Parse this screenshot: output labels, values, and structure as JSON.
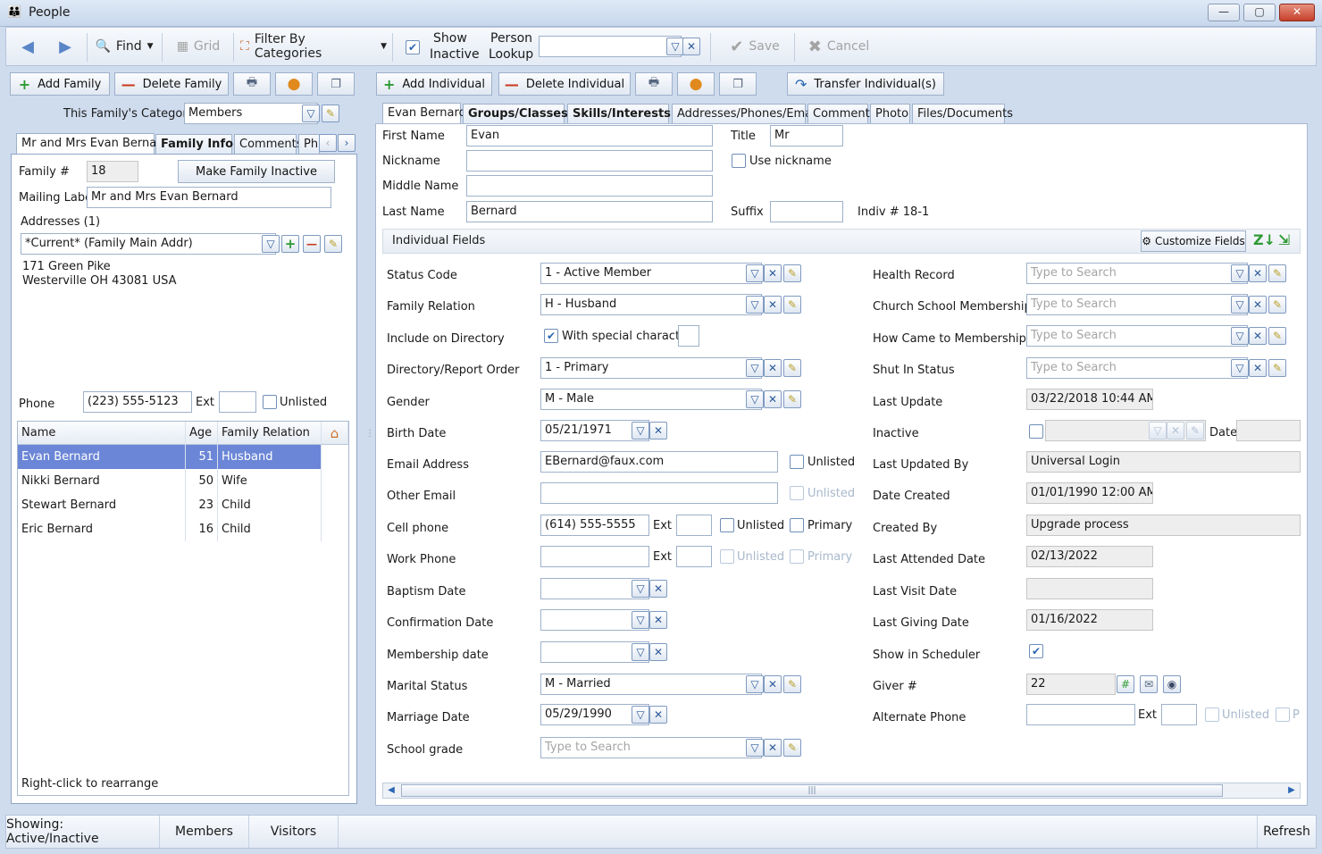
{
  "window": {
    "title": "People"
  },
  "toolbar": {
    "find": "Find",
    "grid": "Grid",
    "filter": "Filter By Categories",
    "show_inactive_1": "Show",
    "show_inactive_2": "Inactive",
    "person_lookup_1": "Person",
    "person_lookup_2": "Lookup",
    "save": "Save",
    "cancel": "Cancel"
  },
  "family": {
    "add": "Add Family",
    "delete": "Delete Family",
    "category_label": "This Family's Category:",
    "category": "Members",
    "tabs": [
      "Mr and Mrs Evan Bernard",
      "Family Info",
      "Comments",
      "Ph"
    ],
    "family_no_label": "Family #",
    "family_no": "18",
    "make_inactive": "Make Family Inactive",
    "mailing_label_label": "Mailing Label",
    "mailing_label": "Mr and Mrs Evan Bernard",
    "addresses_label": "Addresses (1)",
    "address_select": "*Current* (Family Main Addr)",
    "address_line1": "171 Green Pike",
    "address_line2": "Westerville OH  43081 USA",
    "phone_label": "Phone",
    "phone": "(223) 555-5123",
    "ext_label": "Ext",
    "unlisted": "Unlisted",
    "members_cols": [
      "Name",
      "Age",
      "Family Relation"
    ],
    "members": [
      {
        "name": "Evan Bernard",
        "age": "51",
        "rel": "Husband"
      },
      {
        "name": "Nikki Bernard",
        "age": "50",
        "rel": "Wife"
      },
      {
        "name": "Stewart Bernard",
        "age": "23",
        "rel": "Child"
      },
      {
        "name": "Eric Bernard",
        "age": "16",
        "rel": "Child"
      }
    ],
    "rearrange_hint": "Right-click to rearrange"
  },
  "individual": {
    "add": "Add Individual",
    "delete": "Delete Individual",
    "transfer": "Transfer Individual(s)",
    "tabs": [
      "Evan Bernard",
      "Groups/Classes",
      "Skills/Interests",
      "Addresses/Phones/Email",
      "Comments",
      "Photo",
      "Files/Documents"
    ],
    "first_name_label": "First Name",
    "first_name": "Evan",
    "title_label": "Title",
    "title": "Mr",
    "nickname_label": "Nickname",
    "nickname": "",
    "use_nickname": "Use nickname",
    "middle_name_label": "Middle Name",
    "middle_name": "",
    "last_name_label": "Last Name",
    "last_name": "Bernard",
    "suffix_label": "Suffix",
    "suffix": "",
    "indiv_no": "Indiv # 18-1",
    "fields_header": "Individual Fields",
    "customize": "Customize Fields",
    "left": {
      "status_code": {
        "label": "Status Code",
        "value": "1 - Active Member"
      },
      "family_relation": {
        "label": "Family Relation",
        "value": "H - Husband"
      },
      "include_directory": {
        "label": "Include on Directory",
        "special": "With special character"
      },
      "directory_order": {
        "label": "Directory/Report Order",
        "value": "1 - Primary"
      },
      "gender": {
        "label": "Gender",
        "value": "M - Male"
      },
      "birth_date": {
        "label": "Birth Date",
        "value": "05/21/1971"
      },
      "email": {
        "label": "Email Address",
        "value": "EBernard@faux.com",
        "unlisted": "Unlisted"
      },
      "other_email": {
        "label": "Other Email",
        "value": "",
        "unlisted": "Unlisted"
      },
      "cell_phone": {
        "label": "Cell phone",
        "value": "(614) 555-5555",
        "ext": "Ext",
        "unlisted": "Unlisted",
        "primary": "Primary"
      },
      "work_phone": {
        "label": "Work Phone",
        "value": "",
        "ext": "Ext",
        "unlisted": "Unlisted",
        "primary": "Primary"
      },
      "baptism_date": {
        "label": "Baptism Date",
        "value": ""
      },
      "confirmation_date": {
        "label": "Confirmation Date",
        "value": ""
      },
      "membership_date": {
        "label": "Membership date",
        "value": ""
      },
      "marital_status": {
        "label": "Marital Status",
        "value": "M - Married"
      },
      "marriage_date": {
        "label": "Marriage Date",
        "value": "05/29/1990"
      },
      "school_grade": {
        "label": "School grade",
        "placeholder": "Type to Search"
      }
    },
    "right": {
      "health_record": {
        "label": "Health Record",
        "placeholder": "Type to Search"
      },
      "church_school": {
        "label": "Church School Membership",
        "placeholder": "Type to Search"
      },
      "how_came": {
        "label": "How Came to Membership",
        "placeholder": "Type to Search"
      },
      "shut_in": {
        "label": "Shut In Status",
        "placeholder": "Type to Search"
      },
      "last_update": {
        "label": "Last Update",
        "value": "03/22/2018 10:44 AM"
      },
      "inactive": {
        "label": "Inactive",
        "date_label": "Date"
      },
      "last_updated_by": {
        "label": "Last Updated By",
        "value": "Universal Login"
      },
      "date_created": {
        "label": "Date Created",
        "value": "01/01/1990 12:00 AM"
      },
      "created_by": {
        "label": "Created By",
        "value": "Upgrade process"
      },
      "last_attended": {
        "label": "Last Attended Date",
        "value": "02/13/2022"
      },
      "last_visit": {
        "label": "Last Visit Date",
        "value": ""
      },
      "last_giving": {
        "label": "Last Giving Date",
        "value": "01/16/2022"
      },
      "show_scheduler": {
        "label": "Show in Scheduler"
      },
      "giver_no": {
        "label": "Giver #",
        "value": "22"
      },
      "alternate_phone": {
        "label": "Alternate Phone",
        "ext": "Ext",
        "unlisted": "Unlisted",
        "p": "P"
      }
    }
  },
  "status": {
    "showing": "Showing: Active/Inactive",
    "members": "Members",
    "visitors": "Visitors",
    "refresh": "Refresh"
  },
  "colors": {
    "selection": "#6b86d6",
    "accent": "#2b66b3",
    "danger": "#c83a1e",
    "add": "#2f9a35"
  }
}
